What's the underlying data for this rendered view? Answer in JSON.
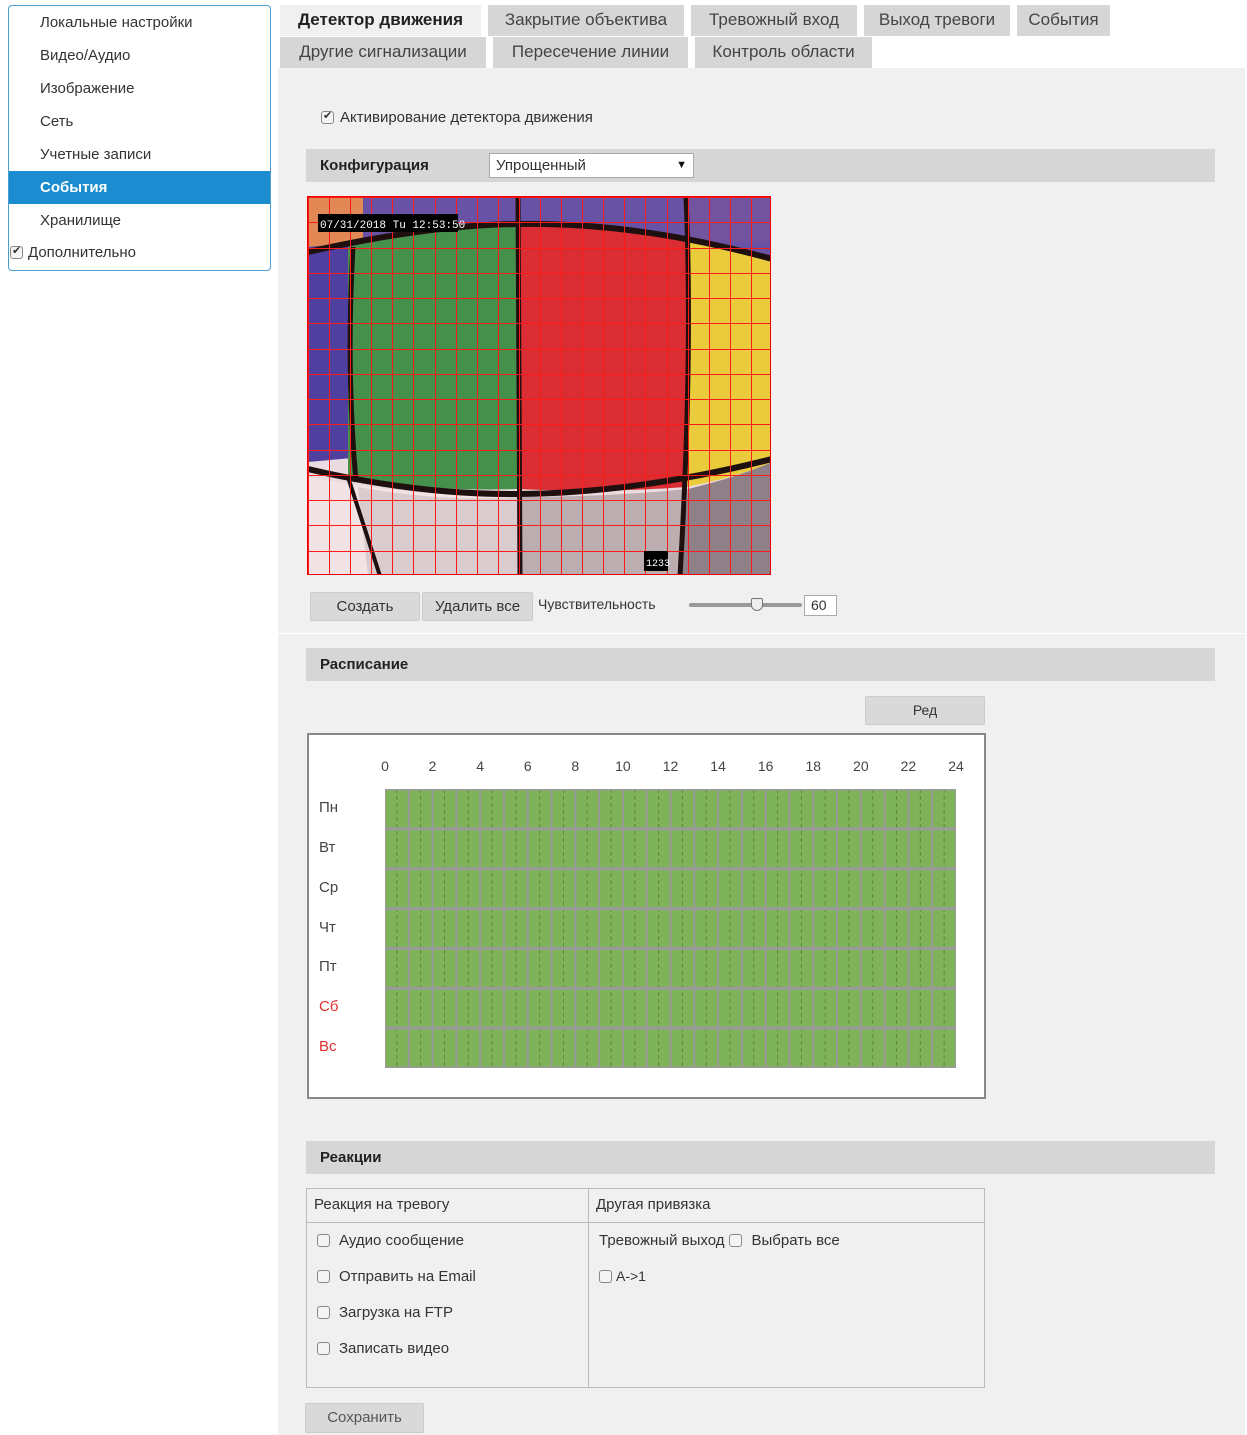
{
  "sidebar": {
    "items": [
      {
        "label": "Локальные настройки"
      },
      {
        "label": "Видео/Аудио"
      },
      {
        "label": "Изображение"
      },
      {
        "label": "Сеть"
      },
      {
        "label": "Учетные записи"
      },
      {
        "label": "События"
      },
      {
        "label": "Хранилище"
      }
    ],
    "active_index": 5,
    "advanced_label": "Дополнительно",
    "advanced_checked": true
  },
  "tabs": {
    "row1": [
      "Детектор движения",
      "Закрытие объектива",
      "Тревожный вход",
      "Выход тревоги",
      "События"
    ],
    "row2": [
      "Другие сигнализации",
      "Пересечение линии",
      "Контроль области"
    ],
    "active": "Детектор движения"
  },
  "motion": {
    "enable_label": "Активирование детектора движения",
    "enabled": true,
    "config_label": "Конфигурация",
    "config_value": "Упрощенный",
    "osd_timestamp": "07/31/2018 Tu 12:53:50",
    "osd_channel": "1233",
    "create_button": "Создать",
    "delete_all_button": "Удалить все",
    "sensitivity_label": "Чувствительность",
    "sensitivity_value": "60",
    "sensitivity_fraction": 0.6
  },
  "schedule": {
    "title": "Расписание",
    "edit_button": "Ред",
    "hours": [
      "0",
      "2",
      "4",
      "6",
      "8",
      "10",
      "12",
      "14",
      "16",
      "18",
      "20",
      "22",
      "24"
    ],
    "days": [
      "Пн",
      "Вт",
      "Ср",
      "Чт",
      "Пт",
      "Сб",
      "Вс"
    ],
    "weekend_color": "#e03030",
    "active_color": "#7fb35a"
  },
  "reactions": {
    "title": "Реакции",
    "col1_header": "Реакция на тревогу",
    "col2_header": "Другая привязка",
    "options": [
      "Аудио сообщение",
      "Отправить на Email",
      "Загрузка на FTP",
      "Записать видео"
    ],
    "alarm_output_label": "Тревожный выход",
    "select_all_label": "Выбрать все",
    "channel_label": "A->1"
  },
  "save_button": "Сохранить",
  "colors": {
    "accent": "#1a8ccf",
    "grid_line": "#ff0000"
  }
}
